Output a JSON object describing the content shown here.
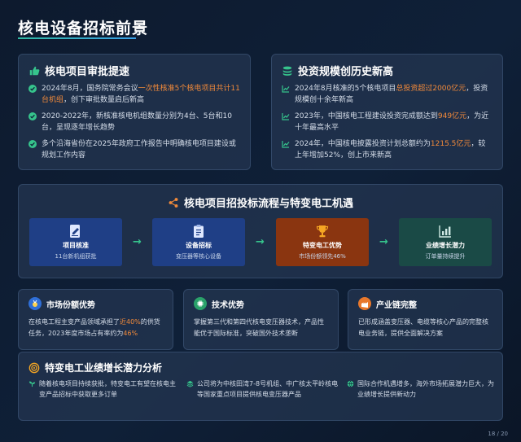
{
  "page": {
    "title": "核电设备招标前景",
    "pager": "18 / 20"
  },
  "approval": {
    "heading": "核电项目审批提速",
    "items": [
      {
        "pre": "2024年8月，国务院常务会议",
        "hl": "一次性核准5个核电项目共计11台机组",
        "post": "，创下审批数量启后新高"
      },
      {
        "pre": "2020-2022年，新核准核电机组数量分别为4台、5台和10台，呈现逐年增长趋势",
        "hl": "",
        "post": ""
      },
      {
        "pre": "多个沿海省份在2025年政府工作报告中明确核电项目建设或规划工作内容",
        "hl": "",
        "post": ""
      }
    ]
  },
  "investment": {
    "heading": "投资规模创历史新高",
    "items": [
      {
        "pre": "2024年8月核准的5个核电项目",
        "hl": "总投资超过2000亿元",
        "post": "，投资规模创十余年新高"
      },
      {
        "pre": "2023年，中国核电工程建设投资完成额达到",
        "hl": "949亿元",
        "post": "，为近十年最高水平"
      },
      {
        "pre": "2024年，中国核电披露投资计划总额约为",
        "hl": "1215.5亿元",
        "post": "，较上年增加52%，创上市来新高"
      }
    ]
  },
  "process": {
    "heading": "核电项目招投标流程与特变电工机遇",
    "steps": [
      {
        "title": "项目核准",
        "sub": "11台新机组获批",
        "color": "#1f3f86"
      },
      {
        "title": "设备招标",
        "sub": "变压器等核心设备",
        "color": "#1f3f86"
      },
      {
        "title": "特变电工优势",
        "sub": "市场份额领先46%",
        "color": "#8a3510"
      },
      {
        "title": "业绩增长潜力",
        "sub": "订单量持续提升",
        "color": "#1a4a46"
      }
    ]
  },
  "market": {
    "heading": "市场份额优势",
    "pre": "在核电工程主变产品领域承担了",
    "hl1": "近40%",
    "mid": "的供货任务，2023年度市场占有率约为",
    "hl2": "46%"
  },
  "tech": {
    "heading": "技术优势",
    "text": "掌握第三代和第四代核电变压器技术，产品性能优于国际标准，突破国外技术垄断"
  },
  "chain": {
    "heading": "产业链完整",
    "text": "已形成涵盖变压器、电缆等核心产品的完整核电业务链，提供全面解决方案"
  },
  "growth": {
    "heading": "特变电工业绩增长潜力分析",
    "items": [
      "随着核电项目持续获批，特变电工有望在核电主变产品招标中获取更多订单",
      "公司将为中核田湾7-8号机组、中广核太平岭核电等国家重点项目提供核电变压器产品",
      "国际合作机遇增多，海外市场拓展潜力巨大，为业绩增长提供新动力"
    ]
  },
  "colors": {
    "accent_orange": "#f28a3a",
    "accent_green": "#36c48c",
    "accent_blue": "#3aa0e8"
  },
  "icons": [
    "thumbs-up-icon",
    "coins-icon",
    "check-circle-icon",
    "chart-line-icon",
    "share-nodes-icon",
    "signature-icon",
    "clipboard-list-icon",
    "trophy-icon",
    "chart-bar-icon",
    "medal-icon",
    "microchip-icon",
    "industry-icon",
    "bullseye-icon",
    "seedling-icon",
    "layers-icon",
    "globe-icon"
  ]
}
